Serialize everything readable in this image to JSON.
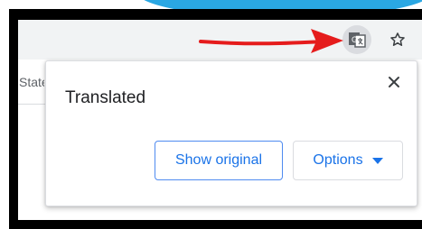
{
  "page": {
    "partial_text": "State"
  },
  "toolbar": {
    "translate_icon": "translate-icon",
    "star_icon": "star-icon"
  },
  "bubble": {
    "title": "Translated",
    "close_icon": "close-icon",
    "show_original_label": "Show original",
    "options_label": "Options"
  },
  "colors": {
    "accent": "#1a73e8",
    "arrow": "#e51c1c"
  }
}
